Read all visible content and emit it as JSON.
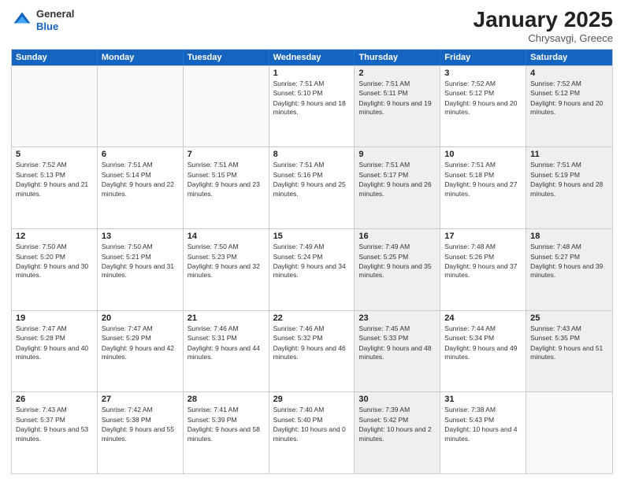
{
  "header": {
    "logo_general": "General",
    "logo_blue": "Blue",
    "month_title": "January 2025",
    "location": "Chrysavgi, Greece"
  },
  "days_of_week": [
    "Sunday",
    "Monday",
    "Tuesday",
    "Wednesday",
    "Thursday",
    "Friday",
    "Saturday"
  ],
  "rows": [
    [
      {
        "day": "",
        "sunrise": "",
        "sunset": "",
        "daylight": "",
        "shaded": false
      },
      {
        "day": "",
        "sunrise": "",
        "sunset": "",
        "daylight": "",
        "shaded": false
      },
      {
        "day": "",
        "sunrise": "",
        "sunset": "",
        "daylight": "",
        "shaded": false
      },
      {
        "day": "1",
        "sunrise": "Sunrise: 7:51 AM",
        "sunset": "Sunset: 5:10 PM",
        "daylight": "Daylight: 9 hours and 18 minutes.",
        "shaded": false
      },
      {
        "day": "2",
        "sunrise": "Sunrise: 7:51 AM",
        "sunset": "Sunset: 5:11 PM",
        "daylight": "Daylight: 9 hours and 19 minutes.",
        "shaded": true
      },
      {
        "day": "3",
        "sunrise": "Sunrise: 7:52 AM",
        "sunset": "Sunset: 5:12 PM",
        "daylight": "Daylight: 9 hours and 20 minutes.",
        "shaded": false
      },
      {
        "day": "4",
        "sunrise": "Sunrise: 7:52 AM",
        "sunset": "Sunset: 5:12 PM",
        "daylight": "Daylight: 9 hours and 20 minutes.",
        "shaded": true
      }
    ],
    [
      {
        "day": "5",
        "sunrise": "Sunrise: 7:52 AM",
        "sunset": "Sunset: 5:13 PM",
        "daylight": "Daylight: 9 hours and 21 minutes.",
        "shaded": false
      },
      {
        "day": "6",
        "sunrise": "Sunrise: 7:51 AM",
        "sunset": "Sunset: 5:14 PM",
        "daylight": "Daylight: 9 hours and 22 minutes.",
        "shaded": false
      },
      {
        "day": "7",
        "sunrise": "Sunrise: 7:51 AM",
        "sunset": "Sunset: 5:15 PM",
        "daylight": "Daylight: 9 hours and 23 minutes.",
        "shaded": false
      },
      {
        "day": "8",
        "sunrise": "Sunrise: 7:51 AM",
        "sunset": "Sunset: 5:16 PM",
        "daylight": "Daylight: 9 hours and 25 minutes.",
        "shaded": false
      },
      {
        "day": "9",
        "sunrise": "Sunrise: 7:51 AM",
        "sunset": "Sunset: 5:17 PM",
        "daylight": "Daylight: 9 hours and 26 minutes.",
        "shaded": true
      },
      {
        "day": "10",
        "sunrise": "Sunrise: 7:51 AM",
        "sunset": "Sunset: 5:18 PM",
        "daylight": "Daylight: 9 hours and 27 minutes.",
        "shaded": false
      },
      {
        "day": "11",
        "sunrise": "Sunrise: 7:51 AM",
        "sunset": "Sunset: 5:19 PM",
        "daylight": "Daylight: 9 hours and 28 minutes.",
        "shaded": true
      }
    ],
    [
      {
        "day": "12",
        "sunrise": "Sunrise: 7:50 AM",
        "sunset": "Sunset: 5:20 PM",
        "daylight": "Daylight: 9 hours and 30 minutes.",
        "shaded": false
      },
      {
        "day": "13",
        "sunrise": "Sunrise: 7:50 AM",
        "sunset": "Sunset: 5:21 PM",
        "daylight": "Daylight: 9 hours and 31 minutes.",
        "shaded": false
      },
      {
        "day": "14",
        "sunrise": "Sunrise: 7:50 AM",
        "sunset": "Sunset: 5:23 PM",
        "daylight": "Daylight: 9 hours and 32 minutes.",
        "shaded": false
      },
      {
        "day": "15",
        "sunrise": "Sunrise: 7:49 AM",
        "sunset": "Sunset: 5:24 PM",
        "daylight": "Daylight: 9 hours and 34 minutes.",
        "shaded": false
      },
      {
        "day": "16",
        "sunrise": "Sunrise: 7:49 AM",
        "sunset": "Sunset: 5:25 PM",
        "daylight": "Daylight: 9 hours and 35 minutes.",
        "shaded": true
      },
      {
        "day": "17",
        "sunrise": "Sunrise: 7:48 AM",
        "sunset": "Sunset: 5:26 PM",
        "daylight": "Daylight: 9 hours and 37 minutes.",
        "shaded": false
      },
      {
        "day": "18",
        "sunrise": "Sunrise: 7:48 AM",
        "sunset": "Sunset: 5:27 PM",
        "daylight": "Daylight: 9 hours and 39 minutes.",
        "shaded": true
      }
    ],
    [
      {
        "day": "19",
        "sunrise": "Sunrise: 7:47 AM",
        "sunset": "Sunset: 5:28 PM",
        "daylight": "Daylight: 9 hours and 40 minutes.",
        "shaded": false
      },
      {
        "day": "20",
        "sunrise": "Sunrise: 7:47 AM",
        "sunset": "Sunset: 5:29 PM",
        "daylight": "Daylight: 9 hours and 42 minutes.",
        "shaded": false
      },
      {
        "day": "21",
        "sunrise": "Sunrise: 7:46 AM",
        "sunset": "Sunset: 5:31 PM",
        "daylight": "Daylight: 9 hours and 44 minutes.",
        "shaded": false
      },
      {
        "day": "22",
        "sunrise": "Sunrise: 7:46 AM",
        "sunset": "Sunset: 5:32 PM",
        "daylight": "Daylight: 9 hours and 46 minutes.",
        "shaded": false
      },
      {
        "day": "23",
        "sunrise": "Sunrise: 7:45 AM",
        "sunset": "Sunset: 5:33 PM",
        "daylight": "Daylight: 9 hours and 48 minutes.",
        "shaded": true
      },
      {
        "day": "24",
        "sunrise": "Sunrise: 7:44 AM",
        "sunset": "Sunset: 5:34 PM",
        "daylight": "Daylight: 9 hours and 49 minutes.",
        "shaded": false
      },
      {
        "day": "25",
        "sunrise": "Sunrise: 7:43 AM",
        "sunset": "Sunset: 5:35 PM",
        "daylight": "Daylight: 9 hours and 51 minutes.",
        "shaded": true
      }
    ],
    [
      {
        "day": "26",
        "sunrise": "Sunrise: 7:43 AM",
        "sunset": "Sunset: 5:37 PM",
        "daylight": "Daylight: 9 hours and 53 minutes.",
        "shaded": false
      },
      {
        "day": "27",
        "sunrise": "Sunrise: 7:42 AM",
        "sunset": "Sunset: 5:38 PM",
        "daylight": "Daylight: 9 hours and 55 minutes.",
        "shaded": false
      },
      {
        "day": "28",
        "sunrise": "Sunrise: 7:41 AM",
        "sunset": "Sunset: 5:39 PM",
        "daylight": "Daylight: 9 hours and 58 minutes.",
        "shaded": false
      },
      {
        "day": "29",
        "sunrise": "Sunrise: 7:40 AM",
        "sunset": "Sunset: 5:40 PM",
        "daylight": "Daylight: 10 hours and 0 minutes.",
        "shaded": false
      },
      {
        "day": "30",
        "sunrise": "Sunrise: 7:39 AM",
        "sunset": "Sunset: 5:42 PM",
        "daylight": "Daylight: 10 hours and 2 minutes.",
        "shaded": true
      },
      {
        "day": "31",
        "sunrise": "Sunrise: 7:38 AM",
        "sunset": "Sunset: 5:43 PM",
        "daylight": "Daylight: 10 hours and 4 minutes.",
        "shaded": false
      },
      {
        "day": "",
        "sunrise": "",
        "sunset": "",
        "daylight": "",
        "shaded": true
      }
    ]
  ]
}
